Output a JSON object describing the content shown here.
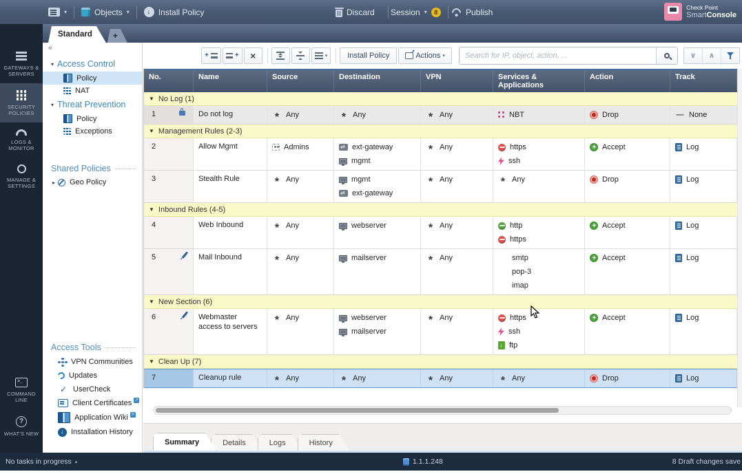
{
  "titlebar": {
    "objects_label": "Objects",
    "install_policy_label": "Install Policy",
    "discard_label": "Discard",
    "session_label": "Session",
    "session_badge": "8",
    "publish_label": "Publish",
    "brand_line1": "Check Point",
    "brand_line2_normal": "Smart",
    "brand_line2_bold": "Console"
  },
  "tabs": {
    "active_label": "Standard",
    "new_tab_label": "+"
  },
  "nav_rail": {
    "items": [
      {
        "id": "gateways",
        "label": "GATEWAYS & SERVERS",
        "icon": "servers-icon"
      },
      {
        "id": "security",
        "label": "SECURITY POLICIES",
        "icon": "grid-icon",
        "active": true
      },
      {
        "id": "logs",
        "label": "LOGS & MONITOR",
        "icon": "gauge-icon"
      },
      {
        "id": "manage",
        "label": "MANAGE & SETTINGS",
        "icon": "gear-icon"
      }
    ],
    "bottom_items": [
      {
        "id": "command-line",
        "label": "COMMAND LINE",
        "icon": "terminal-icon"
      },
      {
        "id": "whats-new",
        "label": "WHAT'S NEW",
        "icon": "question-icon"
      }
    ]
  },
  "sidebar": {
    "collapse_label": "«",
    "tree": [
      {
        "label": "Access Control",
        "children": [
          {
            "label": "Policy",
            "icon": "policy-book",
            "selected": true
          },
          {
            "label": "NAT",
            "icon": "nat-grid"
          }
        ]
      },
      {
        "label": "Threat Prevention",
        "children": [
          {
            "label": "Policy",
            "icon": "policy-book"
          },
          {
            "label": "Exceptions",
            "icon": "exceptions-dots"
          }
        ]
      }
    ],
    "shared_policies": {
      "title": "Shared Policies",
      "items": [
        {
          "label": "Geo Policy",
          "icon": "geo-circle"
        }
      ]
    },
    "access_tools": {
      "title": "Access Tools",
      "items": [
        {
          "label": "VPN Communities",
          "icon": "vpn"
        },
        {
          "label": "Updates",
          "icon": "updates"
        },
        {
          "label": "UserCheck",
          "icon": "usercheck"
        },
        {
          "label": "Client Certificates",
          "icon": "client-cert",
          "external": true
        },
        {
          "label": "Application Wiki",
          "icon": "app-wiki",
          "external": true
        },
        {
          "label": "Installation History",
          "icon": "install-history"
        }
      ]
    }
  },
  "toolbar": {
    "install_policy_label": "Install Policy",
    "actions_label": "Actions",
    "search_placeholder": "Search for IP, object, action, ..."
  },
  "rulebase": {
    "columns": [
      "No.",
      "Name",
      "Source",
      "Destination",
      "VPN",
      "Services & Applications",
      "Action",
      "Track"
    ],
    "sections": [
      {
        "title": "No Log (1)",
        "rows": [
          {
            "no": "1",
            "flag": "lock",
            "shaded": true,
            "name": "Do not log",
            "source": [
              {
                "icon": "any",
                "label": "Any"
              }
            ],
            "destination": [
              {
                "icon": "any",
                "label": "Any"
              }
            ],
            "vpn": [
              {
                "icon": "any",
                "label": "Any"
              }
            ],
            "services": [
              {
                "icon": "nbt",
                "label": "NBT"
              }
            ],
            "action": {
              "icon": "drop",
              "label": "Drop"
            },
            "track": {
              "icon": "none",
              "label": "None"
            }
          }
        ]
      },
      {
        "title": "Management Rules (2-3)",
        "rows": [
          {
            "no": "2",
            "name": "Allow Mgmt",
            "source": [
              {
                "icon": "group",
                "label": "Admins"
              }
            ],
            "destination": [
              {
                "icon": "gateway",
                "label": "ext-gateway"
              },
              {
                "icon": "host",
                "label": "mgmt"
              }
            ],
            "vpn": [
              {
                "icon": "any",
                "label": "Any"
              }
            ],
            "services": [
              {
                "icon": "https",
                "label": "https"
              },
              {
                "icon": "ssh",
                "label": "ssh"
              }
            ],
            "action": {
              "icon": "accept",
              "label": "Accept"
            },
            "track": {
              "icon": "log",
              "label": "Log"
            }
          },
          {
            "no": "3",
            "name": "Stealth Rule",
            "source": [
              {
                "icon": "any",
                "label": "Any"
              }
            ],
            "destination": [
              {
                "icon": "host",
                "label": "mgmt"
              },
              {
                "icon": "gateway",
                "label": "ext-gateway"
              }
            ],
            "vpn": [
              {
                "icon": "any",
                "label": "Any"
              }
            ],
            "services": [
              {
                "icon": "any",
                "label": "Any"
              }
            ],
            "action": {
              "icon": "drop",
              "label": "Drop"
            },
            "track": {
              "icon": "log",
              "label": "Log"
            }
          }
        ]
      },
      {
        "title": "Inbound Rules (4-5)",
        "rows": [
          {
            "no": "4",
            "name": "Web Inbound",
            "source": [
              {
                "icon": "any",
                "label": "Any"
              }
            ],
            "destination": [
              {
                "icon": "host",
                "label": "webserver"
              }
            ],
            "vpn": [
              {
                "icon": "any",
                "label": "Any"
              }
            ],
            "services": [
              {
                "icon": "http",
                "label": "http"
              },
              {
                "icon": "https",
                "label": "https"
              }
            ],
            "action": {
              "icon": "accept",
              "label": "Accept"
            },
            "track": {
              "icon": "log",
              "label": "Log"
            }
          },
          {
            "no": "5",
            "flag": "pencil",
            "name": "Mail Inbound",
            "source": [
              {
                "icon": "any",
                "label": "Any"
              }
            ],
            "destination": [
              {
                "icon": "host",
                "label": "mailserver"
              }
            ],
            "vpn": [
              {
                "icon": "any",
                "label": "Any"
              }
            ],
            "services": [
              {
                "icon": "smtp",
                "label": "smtp"
              },
              {
                "icon": "pop3",
                "label": "pop-3"
              },
              {
                "icon": "imap",
                "label": "imap"
              }
            ],
            "action": {
              "icon": "accept",
              "label": "Accept"
            },
            "track": {
              "icon": "log",
              "label": "Log"
            }
          }
        ]
      },
      {
        "title": "New Section (6)",
        "rows": [
          {
            "no": "6",
            "flag": "pencil",
            "name": "Webmaster access to servers",
            "source": [
              {
                "icon": "any",
                "label": "Any"
              }
            ],
            "destination": [
              {
                "icon": "host",
                "label": "webserver"
              },
              {
                "icon": "host",
                "label": "mailserver"
              }
            ],
            "vpn": [
              {
                "icon": "any",
                "label": "Any"
              }
            ],
            "services": [
              {
                "icon": "https",
                "label": "https"
              },
              {
                "icon": "ssh",
                "label": "ssh"
              },
              {
                "icon": "ftp",
                "label": "ftp"
              }
            ],
            "action": {
              "icon": "accept",
              "label": "Accept"
            },
            "track": {
              "icon": "log",
              "label": "Log"
            }
          }
        ]
      },
      {
        "title": "Clean Up (7)",
        "rows": [
          {
            "no": "7",
            "selected": true,
            "name": "Cleanup rule",
            "source": [
              {
                "icon": "any",
                "label": "Any"
              }
            ],
            "destination": [
              {
                "icon": "any",
                "label": "Any"
              }
            ],
            "vpn": [
              {
                "icon": "any",
                "label": "Any"
              }
            ],
            "services": [
              {
                "icon": "any",
                "label": "Any"
              }
            ],
            "action": {
              "icon": "drop",
              "label": "Drop"
            },
            "track": {
              "icon": "log",
              "label": "Log"
            }
          }
        ]
      }
    ]
  },
  "bottom_tabs": {
    "tabs": [
      {
        "label": "Summary",
        "active": true
      },
      {
        "label": "Details"
      },
      {
        "label": "Logs"
      },
      {
        "label": "History"
      }
    ]
  },
  "statusbar": {
    "tasks_label": "No tasks in progress",
    "server_ip": "1.1.1.248",
    "draft_label": "8 Draft changes save"
  },
  "colors": {
    "accent_blue": "#3f85b5",
    "section_yellow": "#f9f9c8",
    "accept_green": "#4aa83a",
    "drop_red": "#c1271e",
    "selected_row": "#cfe1f4",
    "titlebar": "#4a5b74",
    "rail": "#1b2533",
    "badge_yellow": "#e8b81c",
    "brand_pink": "#e989a9"
  }
}
